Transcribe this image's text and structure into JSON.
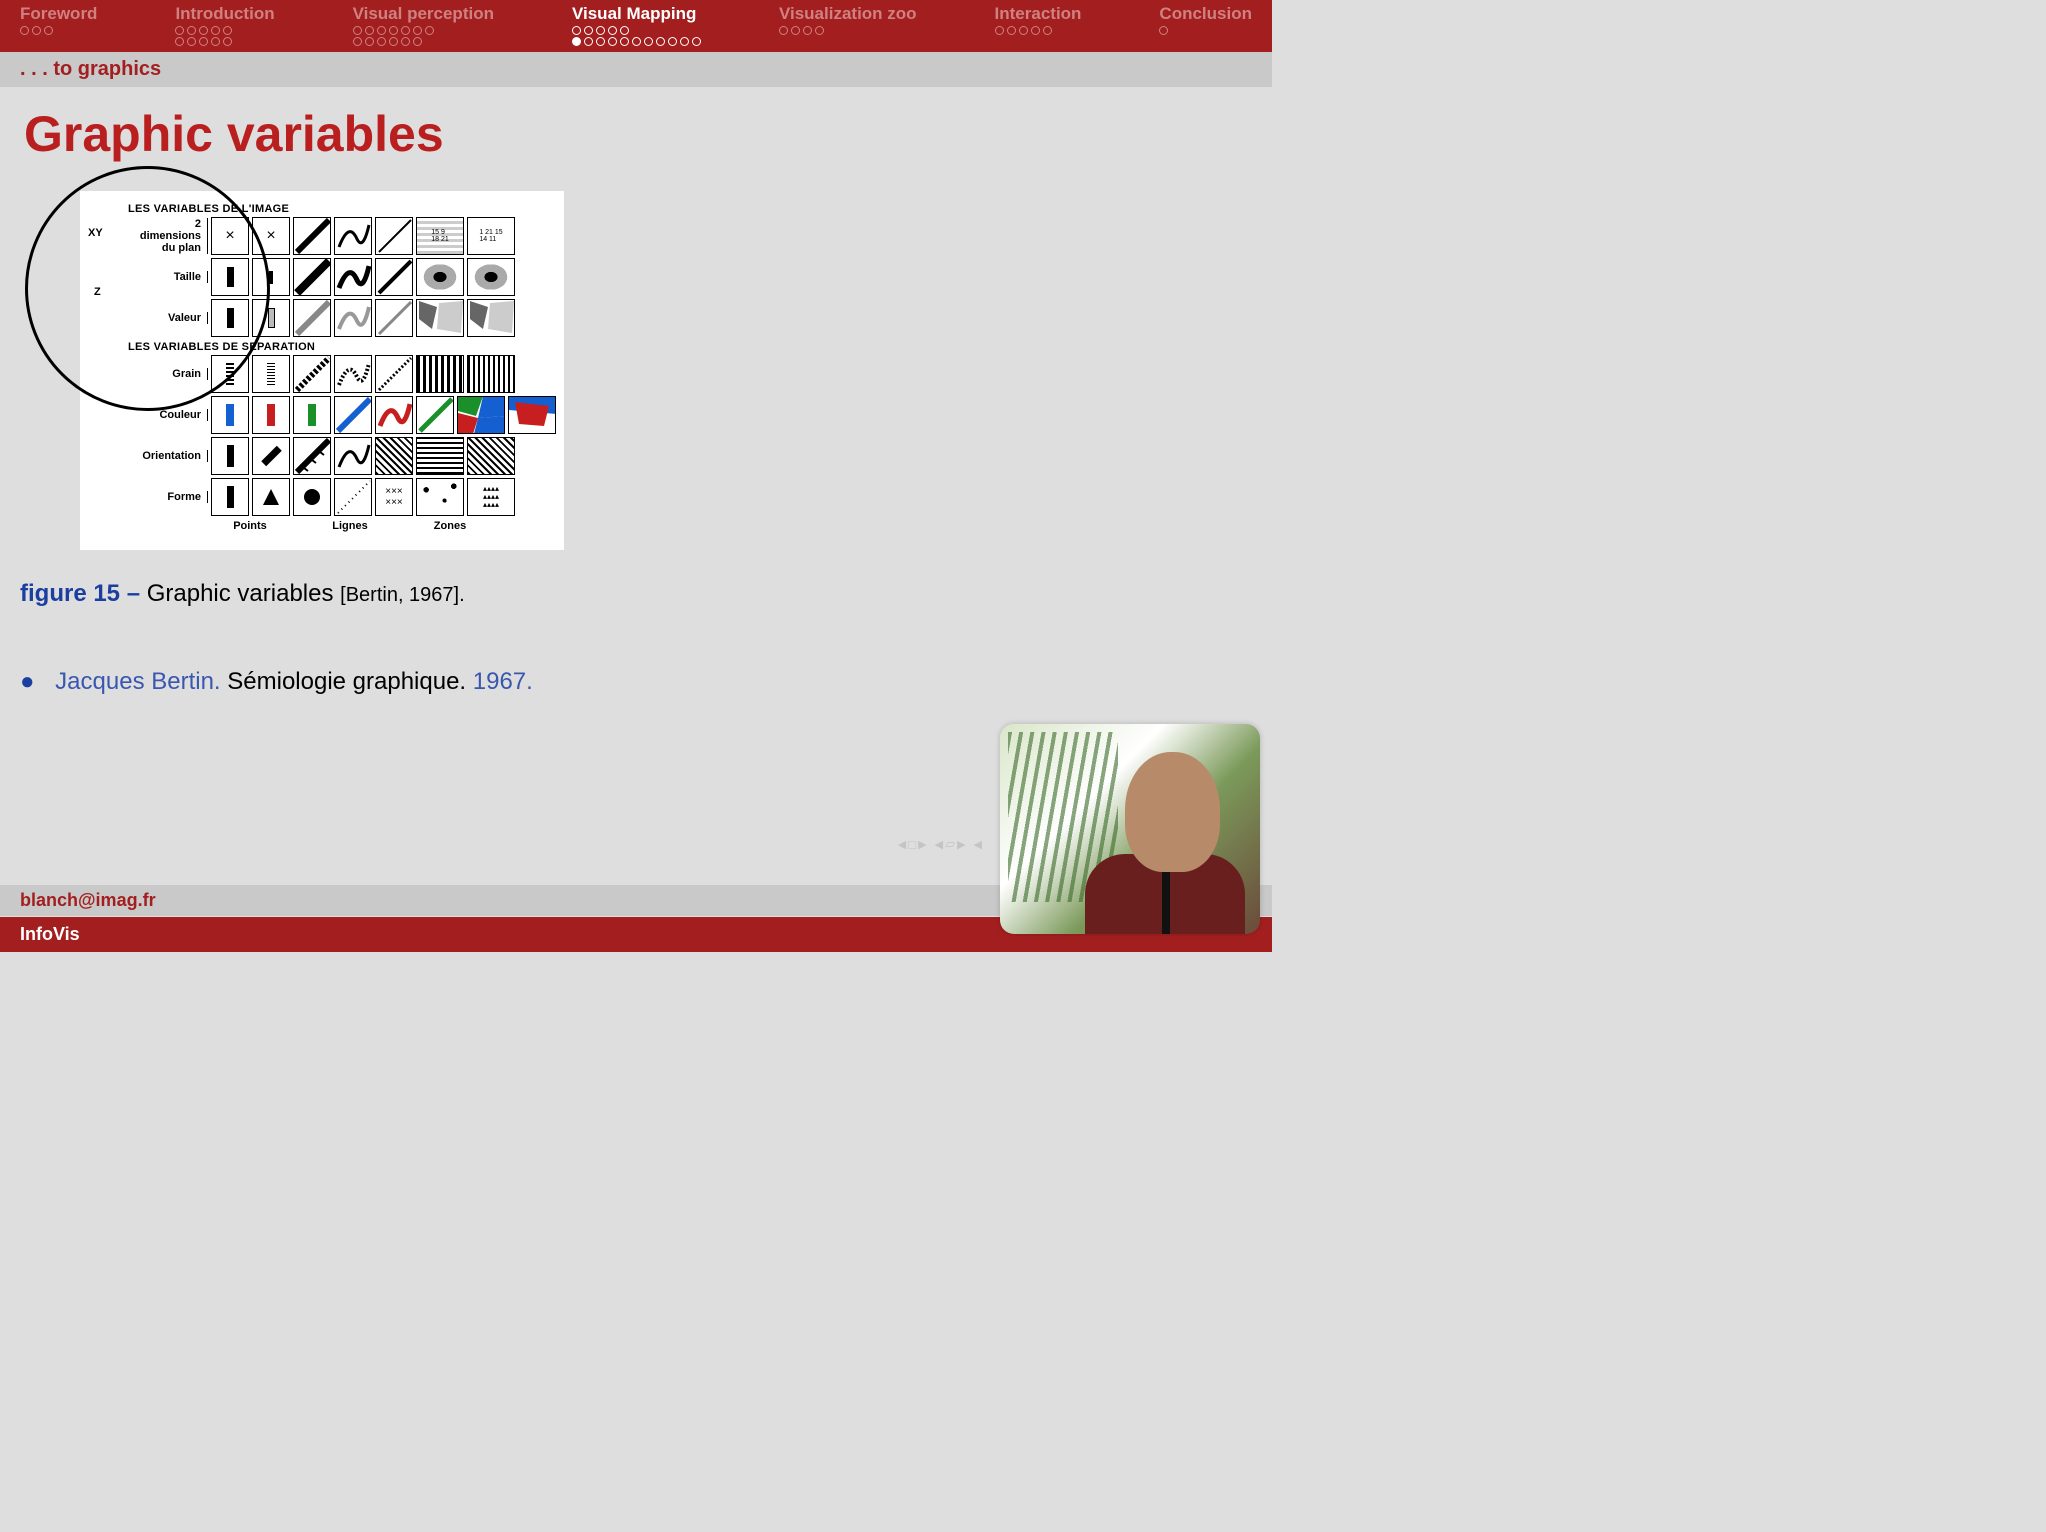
{
  "nav": {
    "items": [
      {
        "label": "Foreword",
        "dots1": 3,
        "dots2": 0,
        "active": false
      },
      {
        "label": "Introduction",
        "dots1": 5,
        "dots2": 5,
        "active": false
      },
      {
        "label": "Visual perception",
        "dots1": 7,
        "dots2": 6,
        "active": false
      },
      {
        "label": "Visual Mapping",
        "dots1": 5,
        "dots2": 11,
        "active": true,
        "fillIndex": 0
      },
      {
        "label": "Visualization zoo",
        "dots1": 4,
        "dots2": 0,
        "active": false
      },
      {
        "label": "Interaction",
        "dots1": 5,
        "dots2": 0,
        "active": false
      },
      {
        "label": "Conclusion",
        "dots1": 1,
        "dots2": 0,
        "active": false
      }
    ]
  },
  "subheading": ". . . to graphics",
  "title": "Graphic variables",
  "diagram": {
    "section1": "LES VARIABLES DE L'IMAGE",
    "xy_label": "XY",
    "xy_text": "2\ndimensions\ndu plan",
    "z_label": "Z",
    "rows_z": [
      "Taille",
      "Valeur"
    ],
    "section2": "LES VARIABLES DE SEPARATION",
    "rows_sep": [
      "Grain",
      "Couleur",
      "Orientation",
      "Forme"
    ],
    "cols": [
      "Points",
      "Lignes",
      "Zones"
    ]
  },
  "caption": {
    "fig_label": "figure 15 –",
    "text": "Graphic variables",
    "cite": "[Bertin, 1967]."
  },
  "reference": {
    "author": "Jacques Bertin.",
    "title": "Sémiologie graphique.",
    "year": "1967."
  },
  "footer": {
    "email": "blanch@imag.fr",
    "course": "InfoVis"
  }
}
